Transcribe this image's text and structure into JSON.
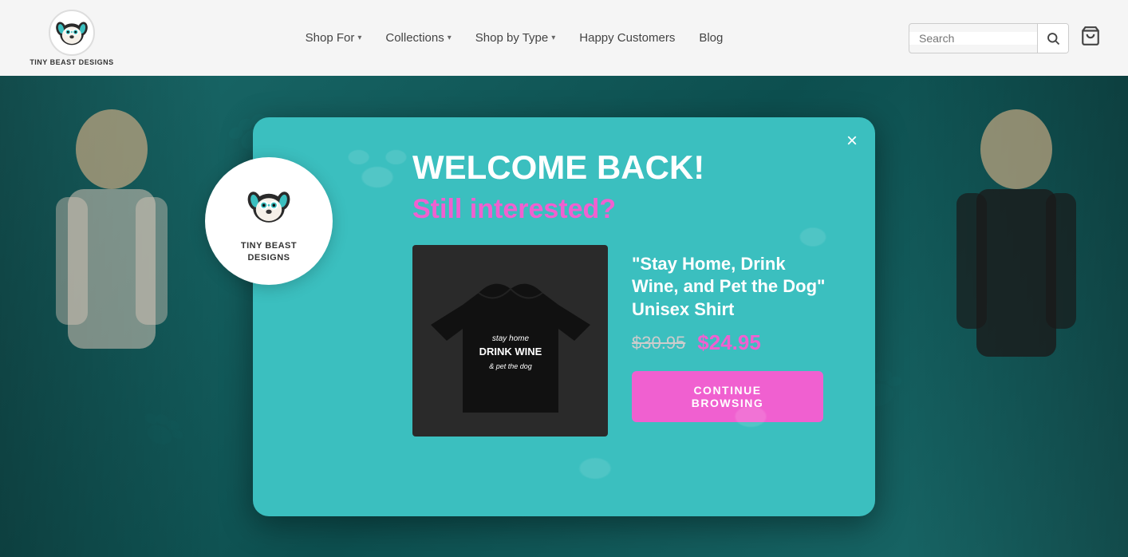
{
  "header": {
    "logo_alt": "Tiny Beast Designs",
    "logo_text": "Tiny Beast Designs",
    "nav_items": [
      {
        "label": "Shop For",
        "has_dropdown": true
      },
      {
        "label": "Collections",
        "has_dropdown": true
      },
      {
        "label": "Shop by Type",
        "has_dropdown": true
      },
      {
        "label": "Happy Customers",
        "has_dropdown": false
      },
      {
        "label": "Blog",
        "has_dropdown": false
      }
    ],
    "search_placeholder": "Search",
    "cart_icon": "🛒"
  },
  "modal": {
    "close_label": "×",
    "title": "WELCOME BACK!",
    "subtitle": "Still interested?",
    "product_name": "\"Stay Home, Drink Wine, and Pet the Dog\" Unisex Shirt",
    "price_old": "$30.95",
    "price_new": "$24.95",
    "cta_label": "CONTINUE BROWSING",
    "logo_text_line1": "Tiny Beast",
    "logo_text_line2": "Designs"
  }
}
